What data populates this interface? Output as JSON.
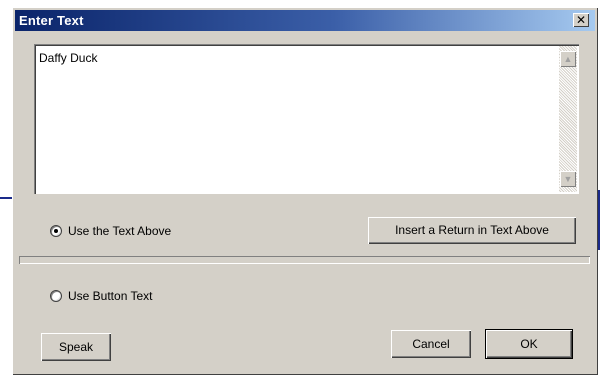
{
  "dialog": {
    "title": "Enter Text",
    "close_label": "✕"
  },
  "textarea": {
    "value": "Daffy Duck"
  },
  "options": {
    "use_text_above": {
      "label": "Use the Text Above",
      "selected": true
    },
    "use_button_text": {
      "label": "Use Button Text",
      "selected": false
    }
  },
  "buttons": {
    "insert_return": "Insert a Return in Text Above",
    "speak": "Speak",
    "cancel": "Cancel",
    "ok": "OK"
  },
  "icons": {
    "scroll_up": "scroll-up-arrow-icon",
    "scroll_down": "scroll-down-arrow-icon",
    "close": "close-icon"
  },
  "colors": {
    "title_start": "#0a246a",
    "title_end": "#a6caf0",
    "face": "#d4d0c8"
  }
}
